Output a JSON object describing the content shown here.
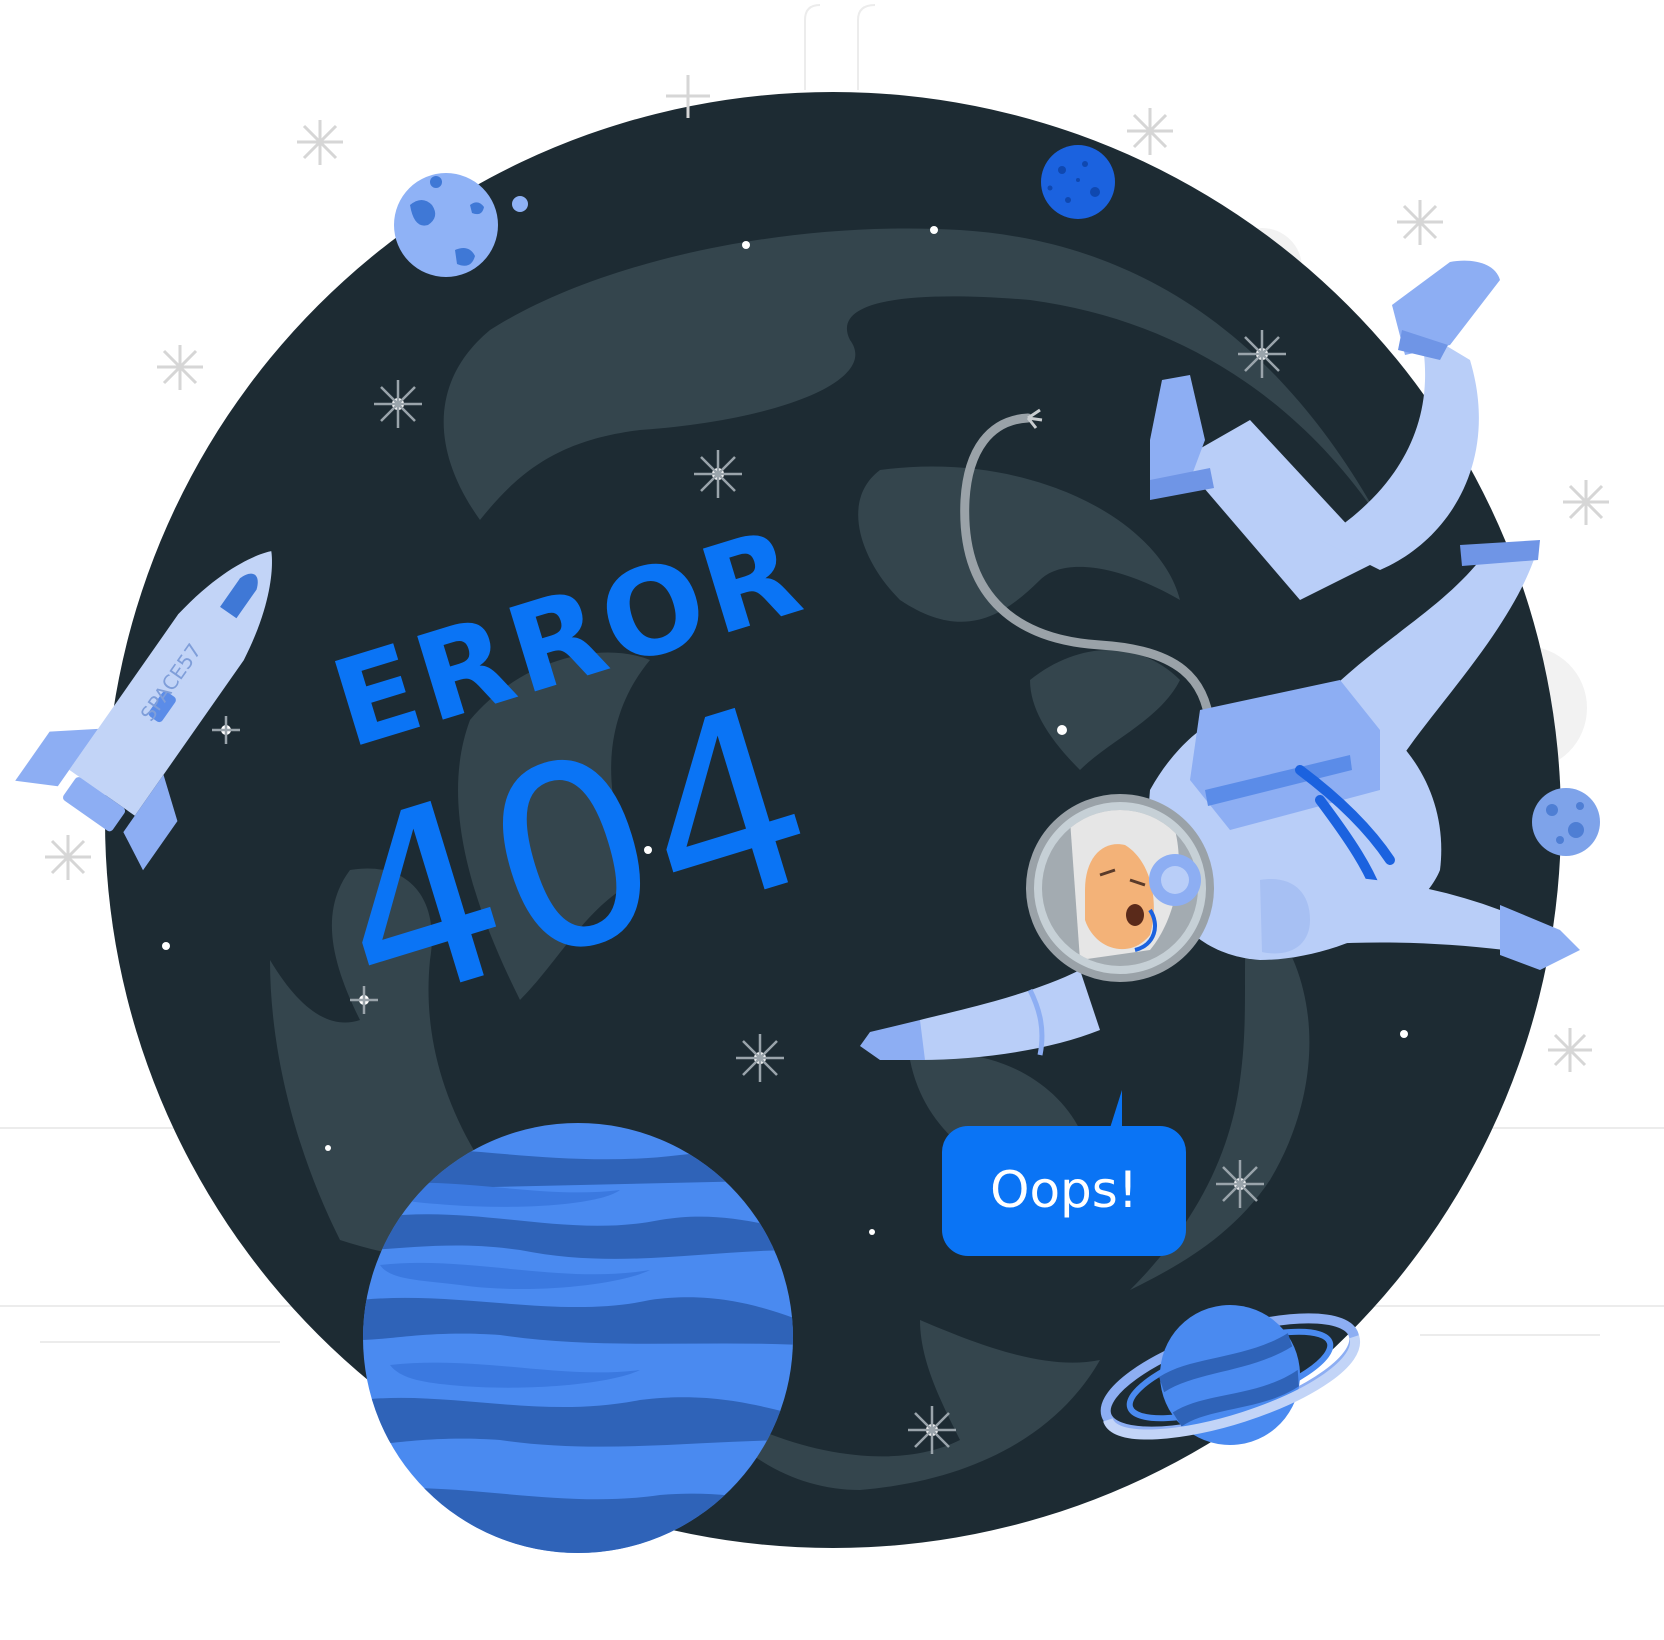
{
  "illustration": {
    "headline": "ERROR",
    "code": "404",
    "speech_bubble": "Oops!",
    "rocket_label": "SPACE57"
  },
  "colors": {
    "space": "#1d2b33",
    "nebula": "#34454d",
    "accent": "#0a74f5",
    "suit": "#b9cef8",
    "suit_dark": "#8daef3",
    "planet": "#4a8af0",
    "planet_stripe": "#2f63b8",
    "skin": "#f3b278"
  },
  "icons": [
    "astronaut",
    "rocket-icon",
    "planet-icon",
    "ringed-planet-icon",
    "moon-icon",
    "star-icon"
  ]
}
